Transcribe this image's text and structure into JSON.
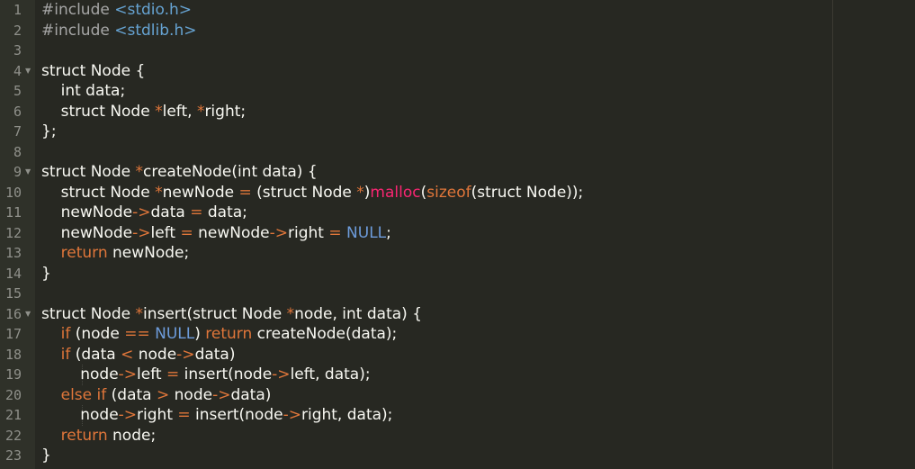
{
  "editor": {
    "lines": [
      {
        "n": "1",
        "tokens": [
          {
            "t": "#include",
            "c": "pre"
          },
          {
            "t": " ",
            "c": "id"
          },
          {
            "t": "<stdio.h>",
            "c": "hdr"
          }
        ]
      },
      {
        "n": "2",
        "tokens": [
          {
            "t": "#include",
            "c": "pre"
          },
          {
            "t": " ",
            "c": "id"
          },
          {
            "t": "<stdlib.h>",
            "c": "hdr"
          }
        ]
      },
      {
        "n": "3",
        "tokens": []
      },
      {
        "n": "4",
        "fold": true,
        "tokens": [
          {
            "t": "struct Node {",
            "c": "id"
          }
        ]
      },
      {
        "n": "5",
        "tokens": [
          {
            "t": "    int data;",
            "c": "id"
          }
        ]
      },
      {
        "n": "6",
        "tokens": [
          {
            "t": "    struct Node ",
            "c": "id"
          },
          {
            "t": "*",
            "c": "ctl"
          },
          {
            "t": "left, ",
            "c": "id"
          },
          {
            "t": "*",
            "c": "ctl"
          },
          {
            "t": "right;",
            "c": "id"
          }
        ]
      },
      {
        "n": "7",
        "tokens": [
          {
            "t": "};",
            "c": "id"
          }
        ]
      },
      {
        "n": "8",
        "tokens": []
      },
      {
        "n": "9",
        "fold": true,
        "tokens": [
          {
            "t": "struct Node ",
            "c": "id"
          },
          {
            "t": "*",
            "c": "ctl"
          },
          {
            "t": "createNode(int data) {",
            "c": "id"
          }
        ]
      },
      {
        "n": "10",
        "tokens": [
          {
            "t": "    struct Node ",
            "c": "id"
          },
          {
            "t": "*",
            "c": "ctl"
          },
          {
            "t": "newNode ",
            "c": "id"
          },
          {
            "t": "=",
            "c": "ctl"
          },
          {
            "t": " (struct Node ",
            "c": "id"
          },
          {
            "t": "*",
            "c": "ctl"
          },
          {
            "t": ")",
            "c": "id"
          },
          {
            "t": "malloc",
            "c": "op"
          },
          {
            "t": "(",
            "c": "id"
          },
          {
            "t": "sizeof",
            "c": "ctl"
          },
          {
            "t": "(struct Node));",
            "c": "id"
          }
        ]
      },
      {
        "n": "11",
        "tokens": [
          {
            "t": "    newNode",
            "c": "id"
          },
          {
            "t": "->",
            "c": "ctl"
          },
          {
            "t": "data ",
            "c": "id"
          },
          {
            "t": "=",
            "c": "ctl"
          },
          {
            "t": " data;",
            "c": "id"
          }
        ]
      },
      {
        "n": "12",
        "tokens": [
          {
            "t": "    newNode",
            "c": "id"
          },
          {
            "t": "->",
            "c": "ctl"
          },
          {
            "t": "left ",
            "c": "id"
          },
          {
            "t": "=",
            "c": "ctl"
          },
          {
            "t": " newNode",
            "c": "id"
          },
          {
            "t": "->",
            "c": "ctl"
          },
          {
            "t": "right ",
            "c": "id"
          },
          {
            "t": "=",
            "c": "ctl"
          },
          {
            "t": " ",
            "c": "id"
          },
          {
            "t": "NULL",
            "c": "const"
          },
          {
            "t": ";",
            "c": "id"
          }
        ]
      },
      {
        "n": "13",
        "tokens": [
          {
            "t": "    ",
            "c": "id"
          },
          {
            "t": "return",
            "c": "ctl"
          },
          {
            "t": " newNode;",
            "c": "id"
          }
        ]
      },
      {
        "n": "14",
        "tokens": [
          {
            "t": "}",
            "c": "id"
          }
        ]
      },
      {
        "n": "15",
        "tokens": []
      },
      {
        "n": "16",
        "fold": true,
        "tokens": [
          {
            "t": "struct Node ",
            "c": "id"
          },
          {
            "t": "*",
            "c": "ctl"
          },
          {
            "t": "insert(struct Node ",
            "c": "id"
          },
          {
            "t": "*",
            "c": "ctl"
          },
          {
            "t": "node, int data) {",
            "c": "id"
          }
        ]
      },
      {
        "n": "17",
        "tokens": [
          {
            "t": "    ",
            "c": "id"
          },
          {
            "t": "if",
            "c": "ctl"
          },
          {
            "t": " (node ",
            "c": "id"
          },
          {
            "t": "==",
            "c": "ctl"
          },
          {
            "t": " ",
            "c": "id"
          },
          {
            "t": "NULL",
            "c": "const"
          },
          {
            "t": ") ",
            "c": "id"
          },
          {
            "t": "return",
            "c": "ctl"
          },
          {
            "t": " createNode(data);",
            "c": "id"
          }
        ]
      },
      {
        "n": "18",
        "tokens": [
          {
            "t": "    ",
            "c": "id"
          },
          {
            "t": "if",
            "c": "ctl"
          },
          {
            "t": " (data ",
            "c": "id"
          },
          {
            "t": "<",
            "c": "ctl"
          },
          {
            "t": " node",
            "c": "id"
          },
          {
            "t": "->",
            "c": "ctl"
          },
          {
            "t": "data)",
            "c": "id"
          }
        ]
      },
      {
        "n": "19",
        "guide": true,
        "tokens": [
          {
            "t": "        node",
            "c": "id"
          },
          {
            "t": "->",
            "c": "ctl"
          },
          {
            "t": "left ",
            "c": "id"
          },
          {
            "t": "=",
            "c": "ctl"
          },
          {
            "t": " insert(node",
            "c": "id"
          },
          {
            "t": "->",
            "c": "ctl"
          },
          {
            "t": "left, data);",
            "c": "id"
          }
        ]
      },
      {
        "n": "20",
        "tokens": [
          {
            "t": "    ",
            "c": "id"
          },
          {
            "t": "else if",
            "c": "ctl"
          },
          {
            "t": " (data ",
            "c": "id"
          },
          {
            "t": ">",
            "c": "ctl"
          },
          {
            "t": " node",
            "c": "id"
          },
          {
            "t": "->",
            "c": "ctl"
          },
          {
            "t": "data)",
            "c": "id"
          }
        ]
      },
      {
        "n": "21",
        "guide": true,
        "tokens": [
          {
            "t": "        node",
            "c": "id"
          },
          {
            "t": "->",
            "c": "ctl"
          },
          {
            "t": "right ",
            "c": "id"
          },
          {
            "t": "=",
            "c": "ctl"
          },
          {
            "t": " insert(node",
            "c": "id"
          },
          {
            "t": "->",
            "c": "ctl"
          },
          {
            "t": "right, data);",
            "c": "id"
          }
        ]
      },
      {
        "n": "22",
        "tokens": [
          {
            "t": "    ",
            "c": "id"
          },
          {
            "t": "return",
            "c": "ctl"
          },
          {
            "t": " node;",
            "c": "id"
          }
        ]
      },
      {
        "n": "23",
        "tokens": [
          {
            "t": "}",
            "c": "id"
          }
        ]
      }
    ]
  }
}
